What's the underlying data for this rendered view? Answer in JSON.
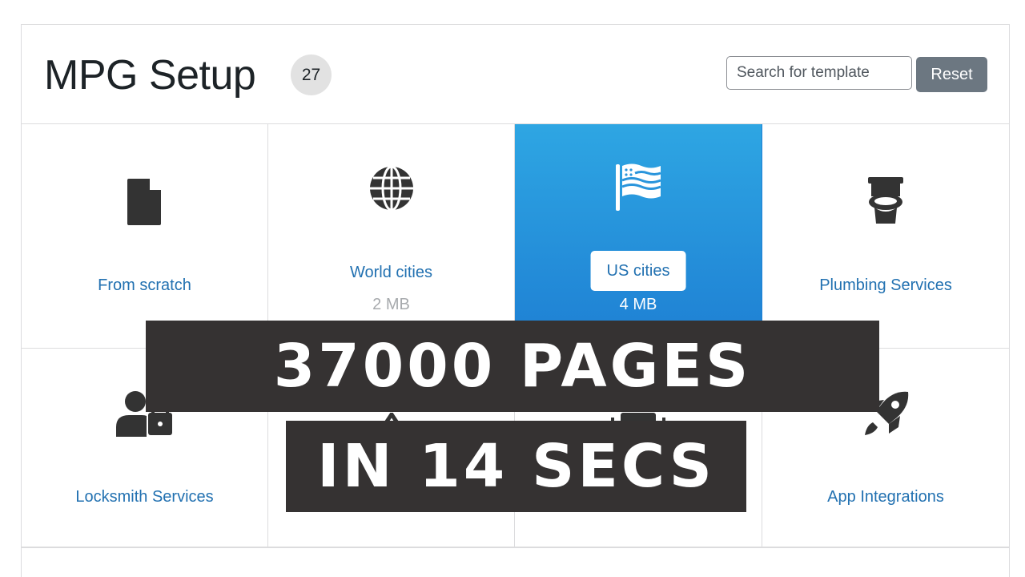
{
  "header": {
    "title": "MPG Setup",
    "count": "27",
    "search_placeholder": "Search for template",
    "reset_label": "Reset"
  },
  "cards": [
    {
      "label": "From scratch",
      "size": "",
      "icon": "file-icon",
      "selected": false
    },
    {
      "label": "World cities",
      "size": "2 MB",
      "icon": "globe-icon",
      "selected": false
    },
    {
      "label": "US cities",
      "size": "4 MB",
      "icon": "us-flag-icon",
      "selected": true
    },
    {
      "label": "Plumbing Services",
      "size": "",
      "icon": "toilet-icon",
      "selected": false
    },
    {
      "label": "Locksmith Services",
      "size": "",
      "icon": "user-lock-icon",
      "selected": false
    },
    {
      "label": "",
      "size": "",
      "icon": "unknown-icon",
      "selected": false
    },
    {
      "label": "",
      "size": "",
      "icon": "unknown-icon",
      "selected": false
    },
    {
      "label": "App Integrations",
      "size": "",
      "icon": "rocket-icon",
      "selected": false
    }
  ],
  "overlay": {
    "line1": "37000 PAGES",
    "line2": "IN 14 SECS"
  },
  "colors": {
    "accent": "#2271b1",
    "selected_top": "#2ea6e3",
    "selected_bottom": "#1e7fd3",
    "overlay_bg": "#353232",
    "reset_bg": "#6c7781"
  }
}
